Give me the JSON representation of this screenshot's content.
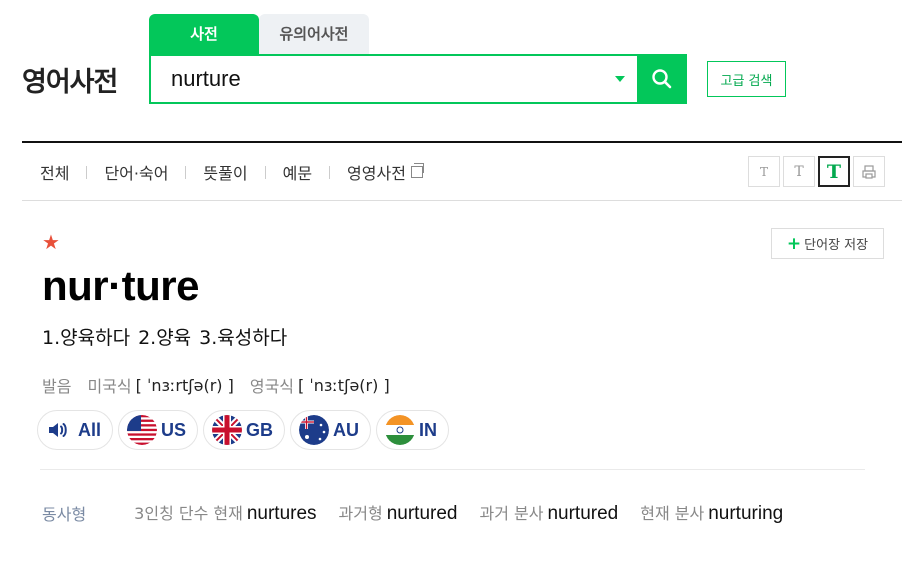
{
  "logo": "영어사전",
  "search_tabs": [
    {
      "label": "사전",
      "active": true
    },
    {
      "label": "유의어사전",
      "active": false
    }
  ],
  "search": {
    "value": "nurture",
    "advanced_label": "고급 검색"
  },
  "nav_tabs": [
    "전체",
    "단어·숙어",
    "뜻풀이",
    "예문",
    "영영사전"
  ],
  "font_tools": {
    "small": "T",
    "mid": "T",
    "big": "T"
  },
  "entry": {
    "star": "★",
    "save_label": "단어장 저장",
    "headword": "nur·ture",
    "meanings": [
      "1.양육하다",
      "2.양육",
      "3.육성하다"
    ],
    "pronunciation": {
      "label": "발음",
      "us_label": "미국식",
      "us_ipa": "[ ˈnɜːrtʃə(r) ]",
      "uk_label": "영국식",
      "uk_ipa": "[ ˈnɜːtʃə(r) ]"
    },
    "audio": [
      "All",
      "US",
      "GB",
      "AU",
      "IN"
    ],
    "forms": {
      "category": "동사형",
      "items": [
        {
          "label": "3인칭 단수 현재",
          "word": "nurtures"
        },
        {
          "label": "과거형",
          "word": "nurtured"
        },
        {
          "label": "과거 분사",
          "word": "nurtured"
        },
        {
          "label": "현재 분사",
          "word": "nurturing"
        }
      ]
    }
  },
  "colors": {
    "accent": "#03c75a",
    "star": "#e8503a",
    "audio_text": "#1d3c8a"
  },
  "icons": [
    "search-icon",
    "dropdown-caret-icon",
    "external-link-icon",
    "print-icon",
    "plus-icon",
    "speaker-icon",
    "us-flag-icon",
    "gb-flag-icon",
    "au-flag-icon",
    "in-flag-icon"
  ]
}
